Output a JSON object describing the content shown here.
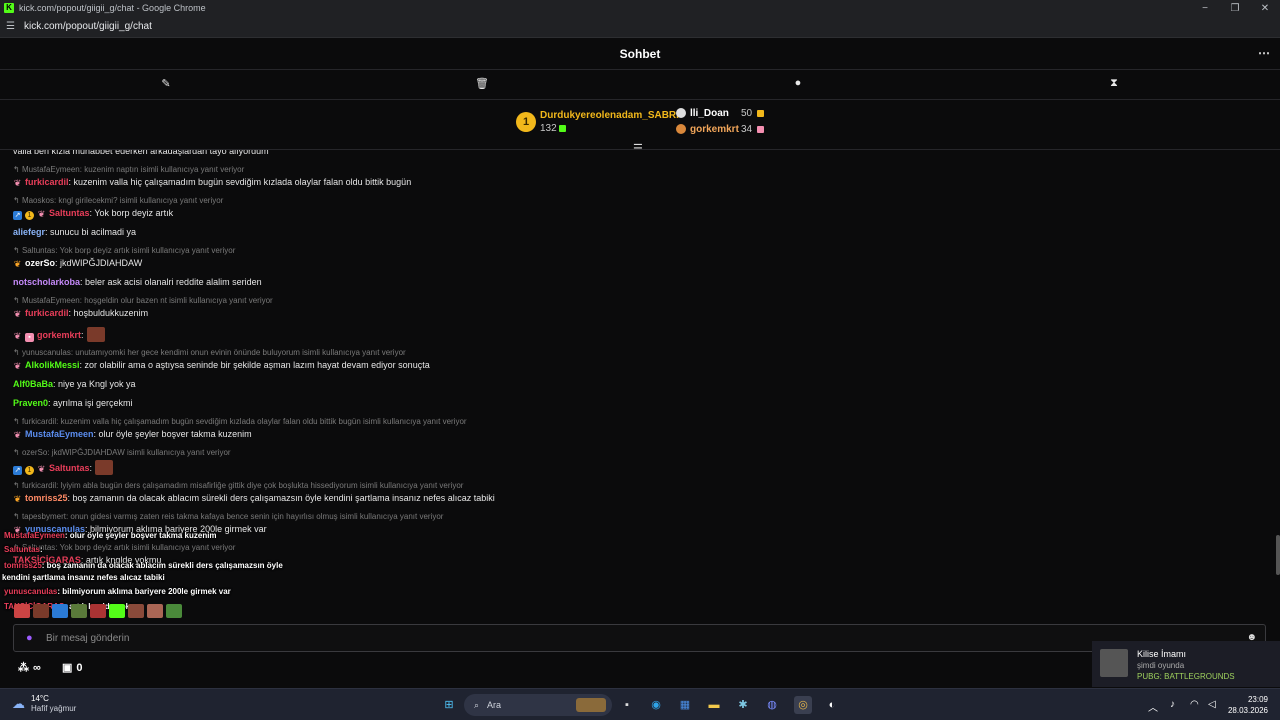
{
  "window": {
    "title": "kick.com/popout/giigii_g/chat - Google Chrome",
    "url": "kick.com/popout/giigii_g/chat",
    "controls": [
      "−",
      "❐",
      "✕"
    ]
  },
  "chat": {
    "header_title": "Sohbet",
    "menu_icon": "⋯",
    "tools": [
      "✎",
      "🗑",
      "●",
      "⧗"
    ]
  },
  "leaderboard": {
    "first": {
      "rank": "1",
      "name": "Durdukyereolenadam_SABRI",
      "count": "132"
    },
    "second": {
      "name": "lli_Doan",
      "count": "50"
    },
    "third": {
      "name": "gorkemkrt",
      "count": "34"
    }
  },
  "messages": [
    {
      "type": "msg",
      "user": "",
      "text": "valla ben kızla muhabbet ederken arkadaşlardan tayo alıyordum",
      "color": "#e93e5a",
      "badges": []
    },
    {
      "type": "reply",
      "text": "MustafaEymeen: kuzenim naptın isimli kullanıcıya yanıt veriyor"
    },
    {
      "type": "msg",
      "user": "furkicardil",
      "text": ": kuzenim valla hiç çalışamadım bugün sevdiğim kızlada olaylar falan oldu bittik bugün",
      "color": "#e93e5a",
      "badges": [
        "butterfly"
      ]
    },
    {
      "type": "reply",
      "text": "Maoskos: kngl girilecekmi? isimli kullanıcıya yanıt veriyor"
    },
    {
      "type": "msg",
      "user": "Saltuntas",
      "text": ": Yok borp deyiz artık",
      "color": "#e93e5a",
      "badges": [
        "blue",
        "gold",
        "butterfly"
      ]
    },
    {
      "type": "msg",
      "user": "aliefegr",
      "text": ": sunucu bi acilmadi ya",
      "color": "#8ab4f8",
      "badges": []
    },
    {
      "type": "reply",
      "text": "Saltuntas: Yok borp deyiz artık isimli kullanıcıya yanıt veriyor"
    },
    {
      "type": "msg",
      "user": "ozerSo",
      "text": ": jkdWIPĞJDIAHDAW",
      "color": "#ffffff",
      "badges": [
        "butterfly-or"
      ]
    },
    {
      "type": "msg",
      "user": "notscholarkoba",
      "text": ": beler ask acisi olanalri reddite alalim seriden",
      "color": "#c58af9",
      "badges": []
    },
    {
      "type": "reply",
      "text": "MustafaEymeen: hoşgeldin olur bazen nt isimli kullanıcıya yanıt veriyor"
    },
    {
      "type": "msg",
      "user": "furkicardil",
      "text": ": hoşbuldukkuzenim",
      "color": "#e93e5a",
      "badges": [
        "butterfly"
      ]
    },
    {
      "type": "msg",
      "user": "gorkemkrt",
      "text": ":",
      "color": "#e93e5a",
      "badges": [
        "butterfly",
        "gift"
      ],
      "emote": true
    },
    {
      "type": "reply",
      "text": "yunuscanulas: unutamıyomki her gece kendimi onun evinin önünde buluyorum isimli kullanıcıya yanıt veriyor"
    },
    {
      "type": "msg",
      "user": "AlkolikMessi",
      "text": ": zor olabilir ama o aştıysa seninde bir şekilde aşman lazım hayat devam ediyor sonuçta",
      "color": "#53fc18",
      "badges": [
        "butterfly"
      ]
    },
    {
      "type": "msg",
      "user": "Alf0BaBa",
      "text": ": niye ya Kngl yok ya",
      "color": "#53fc18",
      "badges": []
    },
    {
      "type": "msg",
      "user": "Praven0",
      "text": ": ayrılma işi gerçekmi",
      "color": "#53fc18",
      "badges": []
    },
    {
      "type": "reply",
      "text": "furkicardil: kuzenim valla hiç çalışamadım bugün sevdiğim kızlada olaylar falan oldu bittik bugün isimli kullanıcıya yanıt veriyor"
    },
    {
      "type": "msg",
      "user": "MustafaEymeen",
      "text": ": olur öyle şeyler boşver takma kuzenim",
      "color": "#5b8def",
      "badges": [
        "butterfly"
      ]
    },
    {
      "type": "reply",
      "text": "ozerSo: jkdWIPĞJDIAHDAW isimli kullanıcıya yanıt veriyor"
    },
    {
      "type": "msg",
      "user": "Saltuntas",
      "text": ":",
      "color": "#e93e5a",
      "badges": [
        "blue",
        "gold",
        "butterfly"
      ],
      "emote": true
    },
    {
      "type": "reply",
      "text": "furkicardil: lyiyim abla bugün ders çalışamadım misafirliğe gittik diye çok boşlukta hissediyorum isimli kullanıcıya yanıt veriyor"
    },
    {
      "type": "msg",
      "user": "tomriss25",
      "text": ": boş zamanın da olacak ablacım sürekli ders çalışamazsın öyle kendini şartlama insanız nefes alıcaz tabiki",
      "color": "#ff8a65",
      "badges": [
        "butterfly-or"
      ]
    },
    {
      "type": "reply",
      "text": "tapesbymert: onun gidesi varmış zaten reis takma kafaya bence senin için hayırlısı olmuş isimli kullanıcıya yanıt veriyor"
    },
    {
      "type": "msg",
      "user": "yunuscanulas",
      "text": ": bilmiyorum aklıma bariyere 200le girmek var",
      "color": "#5b8def",
      "badges": [
        "butterfly"
      ]
    },
    {
      "type": "reply",
      "text": "Saltuntas: Yok borp deyiz artık isimli kullanıcıya yanıt veriyor"
    },
    {
      "type": "msg",
      "user": "TAKSİCİGARAS",
      "text": ": artık knglde yokmu",
      "color": "#e93e5a",
      "badges": []
    }
  ],
  "overlay": [
    {
      "user": "MustafaEymeen",
      "text": ": olur öyle şeyler boşver takma kuzenim"
    },
    {
      "user": "Saltuntas",
      "text": ":"
    },
    {
      "user": "tomriss25",
      "text": ": boş zamanın da olacak ablacım sürekli ders çalışamazsın öyle"
    },
    {
      "user": "",
      "text": "kendini şartlama insanız nefes alıcaz tabiki"
    },
    {
      "user": "yunuscanulas",
      "text": ": bilmiyorum aklıma bariyere 200le girmek var"
    },
    {
      "user": "TAKSİCİGARAS",
      "text": ": artık knglde yokmu"
    }
  ],
  "input": {
    "placeholder": "Bir mesaj gönderin"
  },
  "footer": {
    "points": "∞",
    "gift_count": "0"
  },
  "notification": {
    "title": "Kilise İmamı",
    "status": "şimdi oyunda",
    "game": "PUBG: BATTLEGROUNDS"
  },
  "taskbar": {
    "temp": "14°C",
    "weather": "Hafif yağmur",
    "search": "Ara",
    "time": "23:09",
    "date": "28.03.2026"
  }
}
